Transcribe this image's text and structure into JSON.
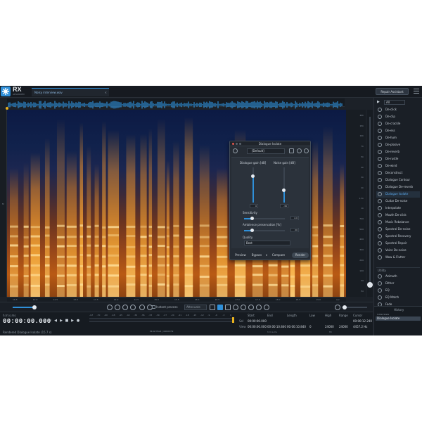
{
  "app": {
    "brand": "RX",
    "brand_sub": "ADVANCED",
    "file_tab": "Noisy interview.wav",
    "repair_assistant": "Repair Assistant"
  },
  "colors": {
    "accent": "#2f8fd8",
    "playhead": "#e9b21f",
    "background": "#1c2128"
  },
  "overview": {
    "label": ""
  },
  "left_ruler": {
    "label": "M"
  },
  "freq_scale": [
    "20k",
    "15k",
    "10k",
    "7k",
    "5k",
    "4k",
    "3k",
    "2k",
    "1.5k",
    "1k",
    "700",
    "500",
    "400",
    "300",
    "200",
    "100",
    "50",
    "Hz"
  ],
  "time_ruler": [
    "16.5",
    "12.0",
    "12.5",
    "13.0",
    "13.5",
    "14.0",
    "14.5",
    "15.0",
    "15.5",
    "16.0",
    "16.5",
    "17.0",
    "17.5",
    "18.0",
    "18.5",
    "19.0",
    "sec"
  ],
  "toolbar": {
    "instant_process": "Instant process",
    "attenuate": "Attenuate"
  },
  "bottom": {
    "format": "h:m:s.ms",
    "timecode": "00:00:00.000",
    "status": "Rendered Dialogue Isolate (15.7 s)",
    "db_labels": [
      "-Inf",
      "-70",
      "-60",
      "-48",
      "-45",
      "-42",
      "-39",
      "-36",
      "-33",
      "-30",
      "-27",
      "-24",
      "-21",
      "-18",
      "-15",
      "-12",
      "-9",
      "-6",
      "-3",
      "0"
    ],
    "bitdepth": "32-bit float | 44100 Hz",
    "selection": {
      "headers": [
        "Start",
        "End",
        "Length",
        "Low",
        "High",
        "Range",
        "Cursor"
      ],
      "sel_label": "Sel",
      "view_label": "View",
      "sel_values": [
        "00:00:00.000",
        "",
        "",
        "",
        "",
        "",
        "00:00:12.240"
      ],
      "view_values": [
        "00:00:00.000",
        "00:00:10.840",
        "00:00:10.840",
        "0",
        "24000",
        "24000",
        "4457.2 Hz"
      ],
      "units": "h:m:s.ms",
      "hz": "Hz"
    }
  },
  "right_panel": {
    "filter": "All",
    "modules": [
      "De-click",
      "De-clip",
      "De-crackle",
      "De-ess",
      "De-hum",
      "De-plosive",
      "De-reverb",
      "De-rustle",
      "De-wind",
      "Deconstruct",
      "Dialogue Contour",
      "Dialogue De-reverb",
      "Dialogue Isolate",
      "Guitar De-noise",
      "Interpolate",
      "Mouth De-click",
      "Music Rebalance",
      "Spectral De-noise",
      "Spectral Recovery",
      "Spectral Repair",
      "Voice De-noise",
      "Wow & Flutter"
    ],
    "selected_module_index": 12,
    "utility_head": "Utility",
    "utility_modules": [
      "Azimuth",
      "Dither",
      "EQ",
      "EQ Match",
      "Fade",
      "Gain"
    ],
    "history_title": "History",
    "history_items": [
      "Initial State",
      "Dialogue Isolate"
    ]
  },
  "dialog": {
    "title": "Dialogue Isolate",
    "preset": "[Default]",
    "dialogue_gain_label": "Dialogue gain [dB]",
    "noise_gain_label": "Noise gain [dB]",
    "dialogue_gain_value": "0",
    "noise_gain_value": "-30",
    "dialogue_gain_level": 0.75,
    "noise_gain_level": 0.35,
    "sensitivity_label": "Sensitivity",
    "sensitivity_value": "2.0",
    "sensitivity_level": 0.2,
    "ambience_label": "Ambience preservation [%]",
    "ambience_value": "20",
    "ambience_level": 0.2,
    "quality_label": "Quality",
    "quality_value": "Best",
    "preview": "Preview",
    "bypass": "Bypass",
    "compare": "Compare",
    "render": "Render"
  }
}
